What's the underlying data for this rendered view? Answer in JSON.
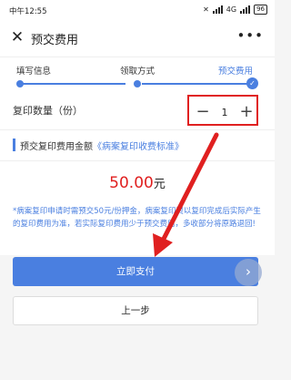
{
  "status_bar": {
    "time": "中午12:55",
    "network": "4G",
    "battery": "96"
  },
  "nav": {
    "close_icon": "close-icon",
    "title": "预交费用",
    "more_icon": "more-icon"
  },
  "steps": [
    {
      "label": "填写信息",
      "state": "done"
    },
    {
      "label": "领取方式",
      "state": "done"
    },
    {
      "label": "预交费用",
      "state": "current"
    }
  ],
  "quantity": {
    "label": "复印数量（份）",
    "minus": "−",
    "value": "1",
    "plus": "+"
  },
  "fee": {
    "label": "预交复印费用金额",
    "link": "《病案复印收费标准》"
  },
  "amount": {
    "value": "50.00",
    "unit": "元"
  },
  "notice": "*病案复印申请时需预交50元/份押金，病案复印费以复印完成后实际产生的复印费用为准，若实际复印费用少于预交费用，多收部分将原路退回!",
  "buttons": {
    "pay": "立即支付",
    "back": "上一步"
  },
  "colors": {
    "accent": "#4a7fe0",
    "amount": "#e02020",
    "annotation": "#e02020"
  }
}
